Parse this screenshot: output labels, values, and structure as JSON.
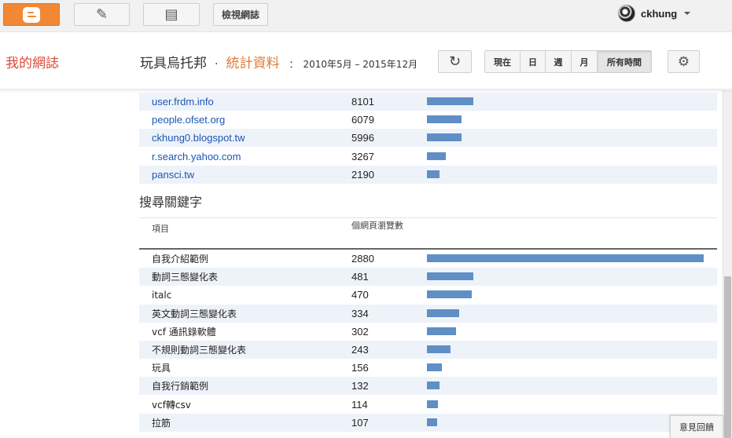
{
  "topbar": {
    "view_blog_label": "檢視網誌",
    "username": "ckhung",
    "icons": {
      "blogger": "blogger-logo-icon",
      "edit": "pencil-icon",
      "posts": "posts-list-icon",
      "avatar": "user-avatar"
    }
  },
  "header": {
    "blog_name": "我的網誌",
    "blog_title": "玩具烏托邦",
    "separator": "·",
    "page_title": "統計資料",
    "colon": "：",
    "date_range": "2010年5月 – 2015年12月",
    "refresh_icon": "↻",
    "range_buttons": [
      "現在",
      "日",
      "週",
      "月",
      "所有時間"
    ],
    "active_range": "所有時間",
    "settings_icon": "⚙"
  },
  "referrers": [
    {
      "name": "user.frdm.info",
      "count": "8101",
      "value": 8101
    },
    {
      "name": "people.ofset.org",
      "count": "6079",
      "value": 6079
    },
    {
      "name": "ckhung0.blogspot.tw",
      "count": "5996",
      "value": 5996
    },
    {
      "name": "r.search.yahoo.com",
      "count": "3267",
      "value": 3267
    },
    {
      "name": "pansci.tw",
      "count": "2190",
      "value": 2190
    }
  ],
  "search_keywords": {
    "title": "搜尋關鍵字",
    "col_item": "項目",
    "col_views": "個網頁瀏覽數",
    "rows": [
      {
        "name": "自我介紹範例",
        "count": "2880",
        "value": 2880
      },
      {
        "name": "動詞三態變化表",
        "count": "481",
        "value": 481
      },
      {
        "name": "italc",
        "count": "470",
        "value": 470
      },
      {
        "name": "英文動詞三態變化表",
        "count": "334",
        "value": 334
      },
      {
        "name": "vcf 通訊錄軟體",
        "count": "302",
        "value": 302
      },
      {
        "name": "不規則動詞三態變化表",
        "count": "243",
        "value": 243
      },
      {
        "name": "玩具",
        "count": "156",
        "value": 156
      },
      {
        "name": "自我行銷範例",
        "count": "132",
        "value": 132
      },
      {
        "name": "vcf轉csv",
        "count": "114",
        "value": 114
      },
      {
        "name": "拉筋",
        "count": "107",
        "value": 107
      }
    ]
  },
  "feedback_label": "意見回饋",
  "colors": {
    "accent": "#f28834",
    "link": "#1a56b5",
    "bar": "#5f8fc5",
    "stripe": "#eef3fa"
  }
}
